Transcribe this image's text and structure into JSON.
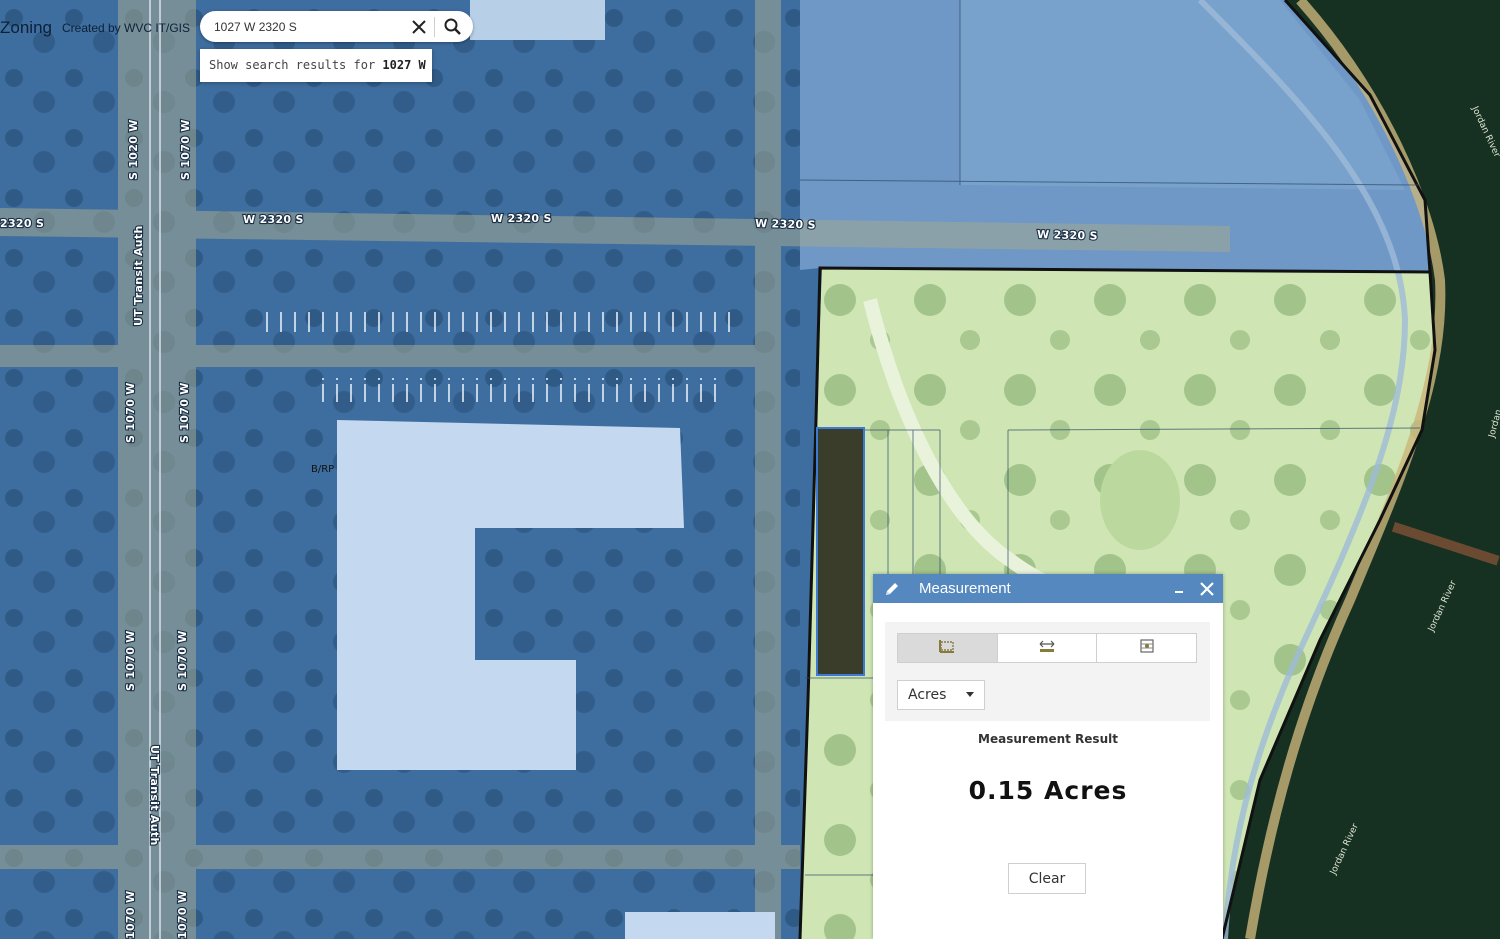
{
  "header": {
    "title": "Zoning",
    "subtitle": "Created by WVC IT/GIS"
  },
  "search": {
    "value": "1027 W 2320 S",
    "suggestion_prefix": "Show search results for ",
    "suggestion_bold": "1027 W",
    "suggestion_suffix": " ..."
  },
  "map": {
    "street_labels": [
      "2320 S",
      "W 2320 S",
      "W 2320 S",
      "W 2320 S",
      "W 2320 S",
      "S 1020 W",
      "S 1070 W",
      "S 1070 W",
      "S 1070 W",
      "S 1070 W",
      "S 1070 W",
      "1070 W",
      "1070 W",
      "UT Transit Auth",
      "UT Transit Auth"
    ],
    "river_labels": [
      "Jordan River",
      "Jordan River",
      "Jordan River",
      "Jordan"
    ],
    "zone_label": "B/RP",
    "colors": {
      "zone_blue": "#4f86c6",
      "zone_green": "#d7efc0",
      "water": "#0f2518",
      "measured_parcel": "#3a3d2a",
      "parcel_outline": "#3c7ad6"
    }
  },
  "measurement": {
    "title": "Measurement",
    "icons": {
      "header": "pencil-icon",
      "minimize": "minimize-icon",
      "close": "close-icon",
      "tools": [
        "area-tool-icon",
        "distance-tool-icon",
        "location-tool-icon"
      ]
    },
    "unit": "Acres",
    "result_label": "Measurement Result",
    "result_value": "0.15 Acres",
    "clear_label": "Clear"
  }
}
